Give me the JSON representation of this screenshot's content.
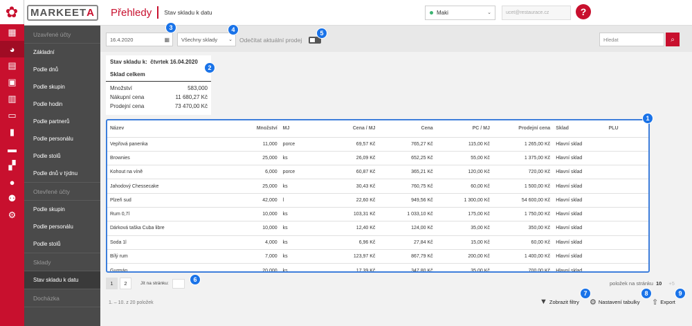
{
  "logo": {
    "brand": "MARKEETA"
  },
  "header": {
    "title": "Přehledy",
    "subtitle": "Stav skladu k datu"
  },
  "user": {
    "name": "Maki",
    "email": "ucet@restaurace.cz"
  },
  "sidebar": {
    "items": [
      {
        "label": "Uzavřené účty",
        "type": "header"
      },
      {
        "label": "Základní"
      },
      {
        "label": "Podle dnů"
      },
      {
        "label": "Podle skupin"
      },
      {
        "label": "Podle hodin"
      },
      {
        "label": "Podle partnerů"
      },
      {
        "label": "Podle personálu"
      },
      {
        "label": "Podle stolů"
      },
      {
        "label": "Podle dnů v týdnu"
      },
      {
        "label": "Otevřené účty",
        "type": "header"
      },
      {
        "label": "Podle skupin"
      },
      {
        "label": "Podle personálu"
      },
      {
        "label": "Podle stolů"
      },
      {
        "label": "Sklady",
        "type": "header"
      },
      {
        "label": "Stav skladu k datu",
        "selected": true
      },
      {
        "label": "Docházka",
        "type": "header"
      }
    ]
  },
  "filters": {
    "date": "16.4.2020",
    "warehouse": "Všechny sklady",
    "subtract_label": "Odečítat aktuální prodej",
    "search_placeholder": "Hledat"
  },
  "badges": [
    "1",
    "2",
    "3",
    "4",
    "5",
    "6",
    "7",
    "8",
    "9"
  ],
  "summary": {
    "title_prefix": "Stav skladu k:",
    "title_date": "čtvrtek 16.04.2020",
    "section": "Sklad celkem",
    "rows": [
      {
        "label": "Množství",
        "value": "583,000"
      },
      {
        "label": "Nákupní cena",
        "value": "11 680,27  Kč"
      },
      {
        "label": "Prodejní cena",
        "value": "73 470,00  Kč"
      }
    ]
  },
  "table": {
    "columns": [
      "Název",
      "Množství",
      "MJ",
      "Cena / MJ",
      "Cena",
      "PC / MJ",
      "Prodejní cena",
      "Sklad",
      "PLU"
    ],
    "rows": [
      [
        "Vepřová panenka",
        "11,000",
        "porce",
        "69,57 Kč",
        "765,27 Kč",
        "115,00 Kč",
        "1 265,00 Kč",
        "Hlavní sklad",
        ""
      ],
      [
        "Brownies",
        "25,000",
        "ks",
        "26,09 Kč",
        "652,25 Kč",
        "55,00 Kč",
        "1 375,00 Kč",
        "Hlavní sklad",
        ""
      ],
      [
        "Kohout na víně",
        "6,000",
        "porce",
        "60,87 Kč",
        "365,21 Kč",
        "120,00 Kč",
        "720,00 Kč",
        "Hlavní sklad",
        ""
      ],
      [
        "Jahodový Chessecake",
        "25,000",
        "ks",
        "30,43 Kč",
        "760,75 Kč",
        "60,00 Kč",
        "1 500,00 Kč",
        "Hlavní sklad",
        ""
      ],
      [
        "Plzeň sud",
        "42,000",
        "l",
        "22,60 Kč",
        "949,56 Kč",
        "1 300,00 Kč",
        "54 600,00 Kč",
        "Hlavní sklad",
        ""
      ],
      [
        "Rum 0,7l",
        "10,000",
        "ks",
        "103,31 Kč",
        "1 033,10 Kč",
        "175,00 Kč",
        "1 750,00 Kč",
        "Hlavní sklad",
        ""
      ],
      [
        "Dárková taška Cuba libre",
        "10,000",
        "ks",
        "12,40 Kč",
        "124,00 Kč",
        "35,00 Kč",
        "350,00 Kč",
        "Hlavní sklad",
        ""
      ],
      [
        "Soda 1l",
        "4,000",
        "ks",
        "6,96 Kč",
        "27,84 Kč",
        "15,00 Kč",
        "60,00 Kč",
        "Hlavní sklad",
        ""
      ],
      [
        "Bílý rum",
        "7,000",
        "ks",
        "123,97 Kč",
        "867,79 Kč",
        "200,00 Kč",
        "1 400,00 Kč",
        "Hlavní sklad",
        ""
      ],
      [
        "Gurmán",
        "20,000",
        "ks",
        "17,39 Kč",
        "347,80 Kč",
        "35,00 Kč",
        "700,00 Kč",
        "Hlavní sklad",
        ""
      ]
    ]
  },
  "pagination": {
    "pages": [
      "1",
      "2"
    ],
    "goto_label": "Jít na stránku:",
    "per_page_label": "položek na stránku",
    "per_page": "10",
    "per_page_alt": "+5",
    "count": "1. – 10. z 20 položek"
  },
  "actions": {
    "filters": "Zobrazit filtry",
    "settings": "Nastavení tabulky",
    "export": "Export"
  }
}
